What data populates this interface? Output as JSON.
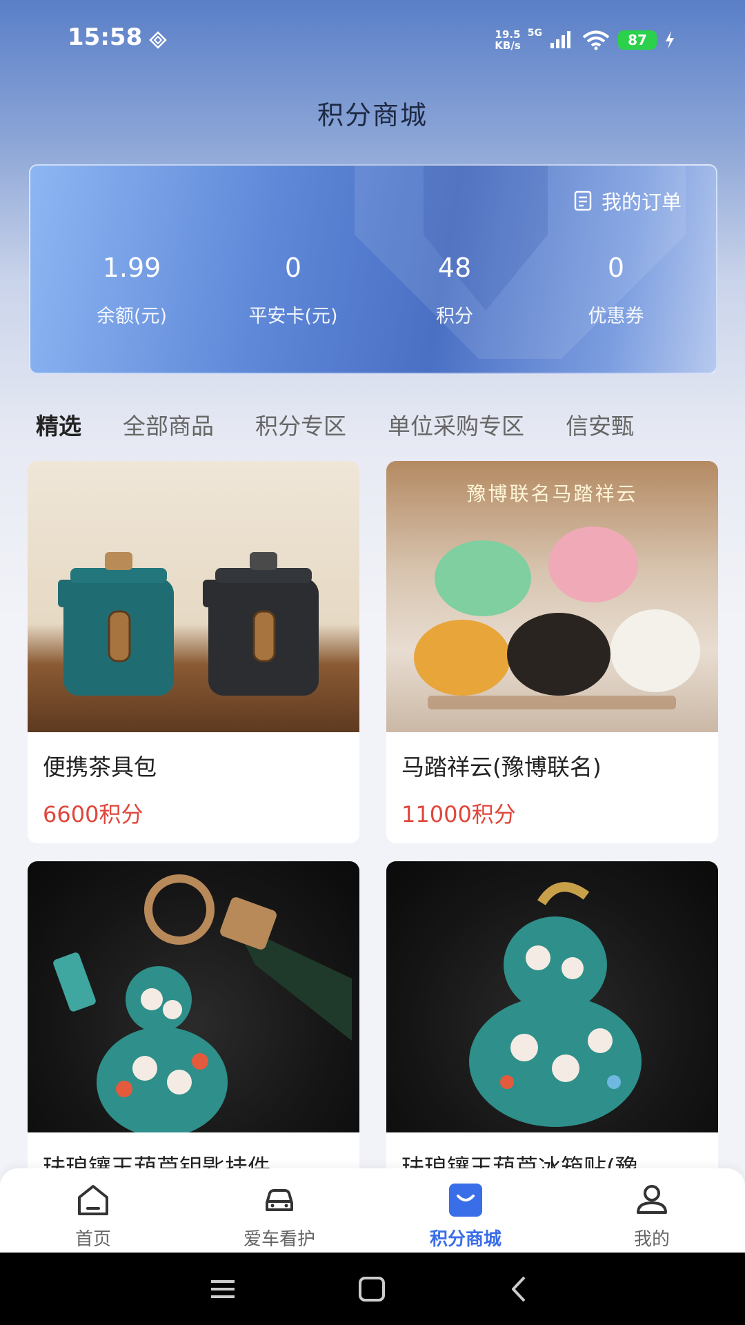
{
  "status_bar": {
    "time": "15:58",
    "net_speed_value": "19.5",
    "net_speed_unit": "KB/s",
    "network": "5G",
    "battery": "87"
  },
  "page": {
    "title": "积分商城"
  },
  "account": {
    "orders_label": "我的订单",
    "stats": [
      {
        "value": "1.99",
        "label": "余额(元)"
      },
      {
        "value": "0",
        "label": "平安卡(元)"
      },
      {
        "value": "48",
        "label": "积分"
      },
      {
        "value": "0",
        "label": "优惠券"
      }
    ]
  },
  "tabs": [
    {
      "label": "精选",
      "active": true
    },
    {
      "label": "全部商品"
    },
    {
      "label": "积分专区"
    },
    {
      "label": "单位采购专区"
    },
    {
      "label": "信安甄"
    }
  ],
  "products": [
    {
      "name": "便携茶具包",
      "price": "6600积分"
    },
    {
      "name": "马踏祥云(豫博联名)",
      "price": "11000积分",
      "banner": "豫博联名马踏祥云"
    },
    {
      "name": "珐琅镶玉葫芦钥匙挂件"
    },
    {
      "name": "珐琅镶玉葫芦冰箱贴(豫"
    }
  ],
  "bottom_nav": [
    {
      "label": "首页",
      "icon": "home-icon"
    },
    {
      "label": "爱车看护",
      "icon": "car-icon"
    },
    {
      "label": "积分商城",
      "icon": "shopping-bag-icon",
      "active": true
    },
    {
      "label": "我的",
      "icon": "user-icon"
    }
  ],
  "colors": {
    "accent": "#3a6ee8",
    "price": "#e0463b",
    "battery": "#2bd14a"
  }
}
